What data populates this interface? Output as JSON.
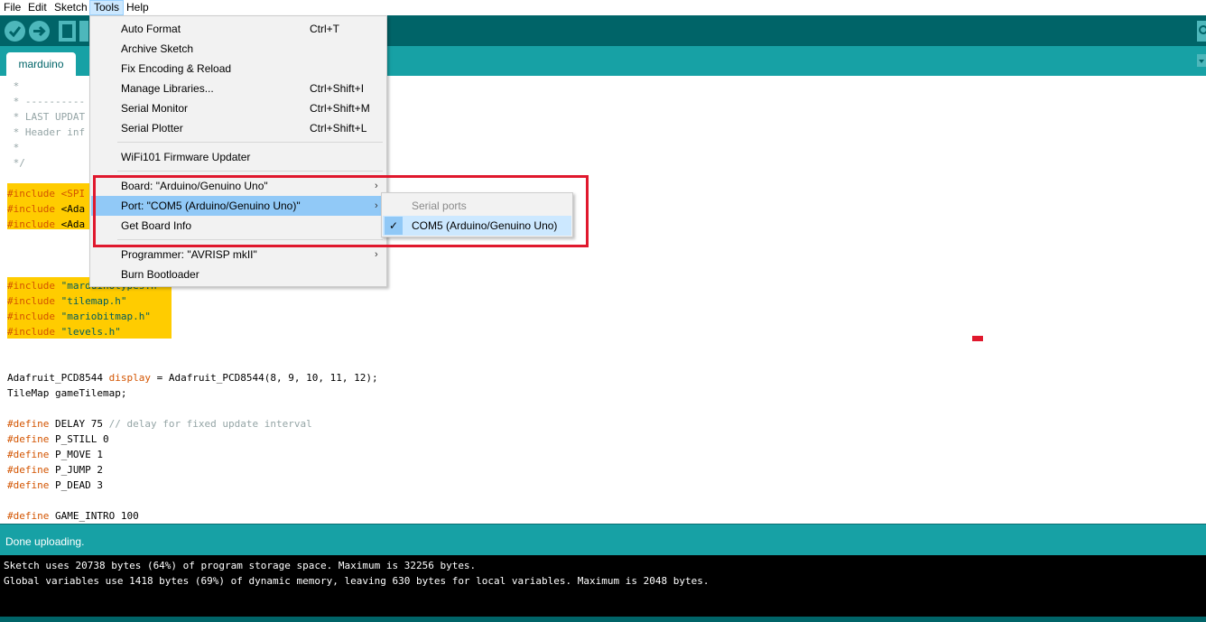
{
  "menubar": {
    "file": "File",
    "edit": "Edit",
    "sketch": "Sketch",
    "tools": "Tools",
    "help": "Help"
  },
  "toolbar": {
    "verify_icon": "check-icon",
    "upload_icon": "arrow-right-icon",
    "new_icon": "new-document-icon",
    "serial_icon": "magnifier-icon"
  },
  "tab": {
    "name": "marduino"
  },
  "code": {
    "c1": " *",
    "c2": " * ----------",
    "c3": " * LAST UPDAT",
    "c4": " * Header inf",
    "c5": " *",
    "c6": " */",
    "inc1_kw": "#include",
    "inc1_rest": " <SPI",
    "inc2_kw": "#include",
    "inc2_rest": " <Ada",
    "inc3_kw": "#include",
    "inc3_rest": " <Ada",
    "inc4_kw": "#include",
    "inc4_str": " \"marduinotypes.h\"",
    "inc5_kw": "#include",
    "inc5_str": " \"tilemap.h\"",
    "inc6_kw": "#include",
    "inc6_str": " \"mariobitmap.h\"",
    "inc7_kw": "#include",
    "inc7_str": " \"levels.h\"",
    "l1a": "Adafruit_PCD8544 ",
    "l1b": "display",
    "l1c": " = Adafruit_PCD8544(8, 9, 10, 11, 12);",
    "l2": "TileMap gameTilemap;",
    "d1_kw": "#define",
    "d1_rest": " DELAY 75 ",
    "d1_cm": "// delay for fixed update interval",
    "d2_kw": "#define",
    "d2_rest": " P_STILL 0",
    "d3_kw": "#define",
    "d3_rest": " P_MOVE 1",
    "d4_kw": "#define",
    "d4_rest": " P_JUMP 2",
    "d5_kw": "#define",
    "d5_rest": " P_DEAD 3",
    "d6_kw": "#define",
    "d6_rest": " GAME_INTRO 100"
  },
  "status": {
    "message": "Done uploading."
  },
  "console": {
    "line1": "Sketch uses 20738 bytes (64%) of program storage space. Maximum is 32256 bytes.",
    "line2": "Global variables use 1418 bytes (69%) of dynamic memory, leaving 630 bytes for local variables. Maximum is 2048 bytes."
  },
  "tools_menu": {
    "auto_format": "Auto Format",
    "auto_format_sc": "Ctrl+T",
    "archive_sketch": "Archive Sketch",
    "fix_encoding": "Fix Encoding & Reload",
    "manage_libraries": "Manage Libraries...",
    "manage_libraries_sc": "Ctrl+Shift+I",
    "serial_monitor": "Serial Monitor",
    "serial_monitor_sc": "Ctrl+Shift+M",
    "serial_plotter": "Serial Plotter",
    "serial_plotter_sc": "Ctrl+Shift+L",
    "wifi_updater": "WiFi101 Firmware Updater",
    "board": "Board: \"Arduino/Genuino Uno\"",
    "port": "Port: \"COM5 (Arduino/Genuino Uno)\"",
    "board_info": "Get Board Info",
    "programmer": "Programmer: \"AVRISP mkII\"",
    "burn_bootloader": "Burn Bootloader",
    "arrow": "›"
  },
  "port_submenu": {
    "header": "Serial ports",
    "com5": "COM5 (Arduino/Genuino Uno)",
    "check": "✓"
  },
  "colors": {
    "toolbar": "#006468",
    "tabstrip": "#17a1a5",
    "highlight": "#ffcc00",
    "annotation": "#e0182d",
    "menu_hover": "#91c9f7"
  }
}
